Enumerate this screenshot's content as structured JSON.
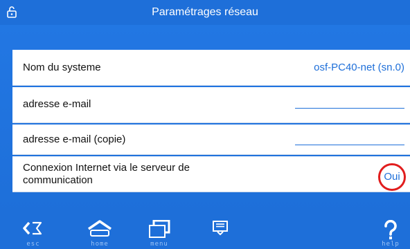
{
  "header": {
    "title": "Paramétrages réseau",
    "lock_icon": "lock-open-icon"
  },
  "rows": [
    {
      "label": "Nom du systeme",
      "value": "osf-PC40-net (sn.0)"
    },
    {
      "label": "adresse e-mail",
      "value": ""
    },
    {
      "label": "adresse e-mail (copie)",
      "value": ""
    },
    {
      "label": "Connexion Internet via le serveur de communication",
      "value": "Oui"
    }
  ],
  "footer": {
    "esc": "esc",
    "home": "home",
    "menu": "menu",
    "help": "help"
  },
  "colors": {
    "accent": "#1e6fd9",
    "highlight": "#e11d1d",
    "panel": "#ffffff"
  }
}
